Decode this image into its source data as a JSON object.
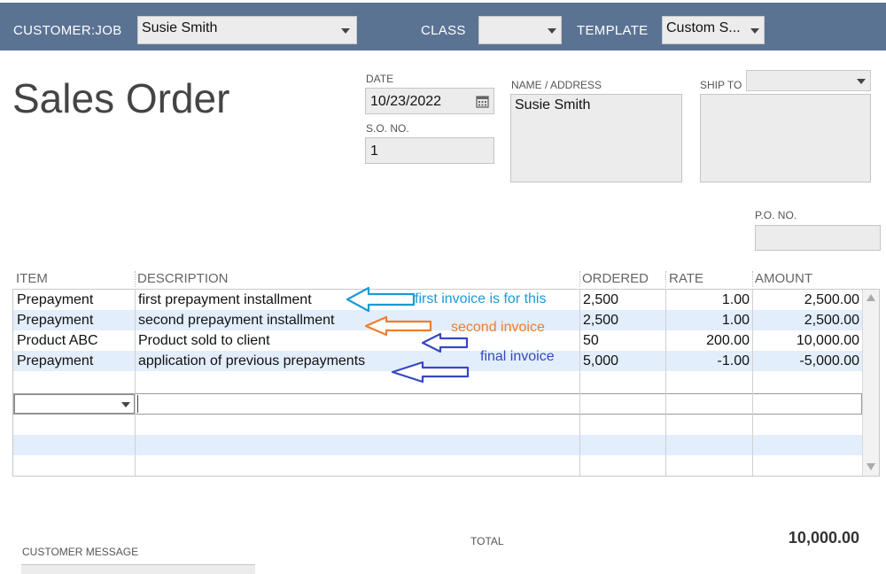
{
  "header": {
    "customer_job_label": "CUSTOMER:JOB",
    "customer_job_value": "Susie Smith",
    "class_label": "CLASS",
    "class_value": "",
    "template_label": "TEMPLATE",
    "template_value": "Custom S..."
  },
  "form": {
    "title": "Sales Order",
    "date_label": "DATE",
    "date_value": "10/23/2022",
    "so_no_label": "S.O. NO.",
    "so_no_value": "1",
    "name_address_label": "NAME / ADDRESS",
    "name_address_value": "Susie Smith",
    "ship_to_label": "SHIP TO",
    "ship_to_value": "",
    "po_no_label": "P.O. NO.",
    "po_no_value": ""
  },
  "table": {
    "columns": [
      "ITEM",
      "DESCRIPTION",
      "ORDERED",
      "RATE",
      "AMOUNT"
    ],
    "rows": [
      {
        "item": "Prepayment",
        "description": "first prepayment installment",
        "ordered": "2,500",
        "rate": "1.00",
        "amount": "2,500.00"
      },
      {
        "item": "Prepayment",
        "description": "second prepayment installment",
        "ordered": "2,500",
        "rate": "1.00",
        "amount": "2,500.00"
      },
      {
        "item": "Product ABC",
        "description": "Product sold to client",
        "ordered": "50",
        "rate": "200.00",
        "amount": "10,000.00"
      },
      {
        "item": "Prepayment",
        "description": "application of previous prepayments",
        "ordered": "5,000",
        "rate": "-1.00",
        "amount": "-5,000.00"
      }
    ]
  },
  "annotations": {
    "first": "first invoice is for this",
    "second": "second invoice",
    "final": "final invoice",
    "colors": {
      "first": "#1a9bd7",
      "second": "#f07d2a",
      "final": "#3548c0"
    }
  },
  "footer": {
    "customer_message_label": "CUSTOMER MESSAGE",
    "total_label": "TOTAL",
    "total_value": "10,000.00"
  }
}
